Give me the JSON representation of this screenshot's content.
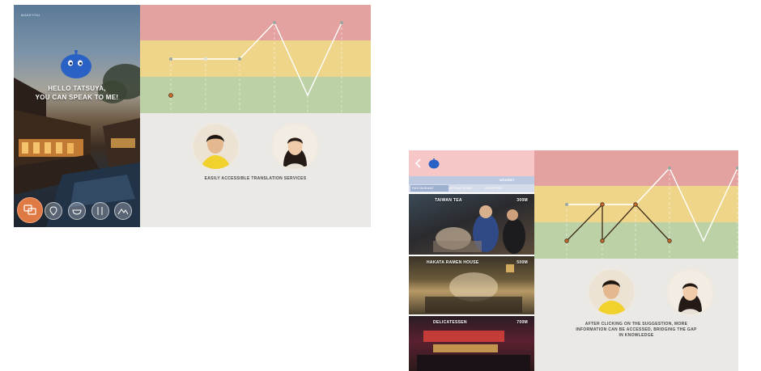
{
  "screen1": {
    "brand": "MAKEYOU",
    "greeting_line1": "HELLO TATSUYA,",
    "greeting_line2": "YOU CAN SPEAK TO ME!",
    "caption": "EASILY ACCESSIBLE TRANSLATION SERVICES",
    "nav_icons": [
      "translate-icon",
      "location-pin-icon",
      "food-bowl-icon",
      "fork-knife-icon",
      "mountain-icon"
    ]
  },
  "screen2": {
    "filter_label": "NEARBY",
    "tabs": [
      "RESTAURANT",
      "ATTRACTIONS",
      "SHOPPING"
    ],
    "restaurants": [
      {
        "name": "TAIWAN TEA",
        "distance": "300M"
      },
      {
        "name": "HAKATA RAMEN HOUSE",
        "distance": "500M"
      },
      {
        "name": "DELICATESSEN",
        "distance": "700M"
      }
    ],
    "caption_line1": "AFTER CLICKING ON THE SUGGESTION, MORE",
    "caption_line2": "INFORMATION CAN BE ACCESSED, BRIDGING THE GAP",
    "caption_line3": "IN KNOWLEDGE"
  },
  "colors": {
    "band_red": "#e3a1a0",
    "band_yellow": "#eed58a",
    "band_green": "#bcd2a6",
    "panel_grey": "#eae9e6",
    "accent_orange": "#e07a45",
    "mascot_blue": "#2a61c4",
    "line_white": "#ffffff",
    "line_dark": "#5a3a22"
  }
}
